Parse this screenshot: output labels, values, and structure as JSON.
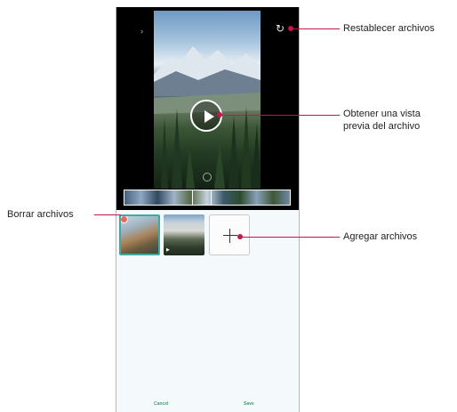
{
  "app": {
    "date_text": "",
    "reset_label": "",
    "cancel_label": "Cancel",
    "save_label": "Save"
  },
  "callouts": {
    "reset": "Restablecer archivos",
    "preview_line1": "Obtener una vista",
    "preview_line2": "previa del archivo",
    "delete": "Borrar archivos",
    "add": "Agregar archivos"
  },
  "icons": {
    "play": "play-icon",
    "reset": "reset-icon",
    "add": "plus-icon",
    "delete": "delete-dot-icon"
  },
  "colors": {
    "callout_line": "#c4164a",
    "accent": "#41a8a2",
    "action_text": "#3fa46a"
  }
}
